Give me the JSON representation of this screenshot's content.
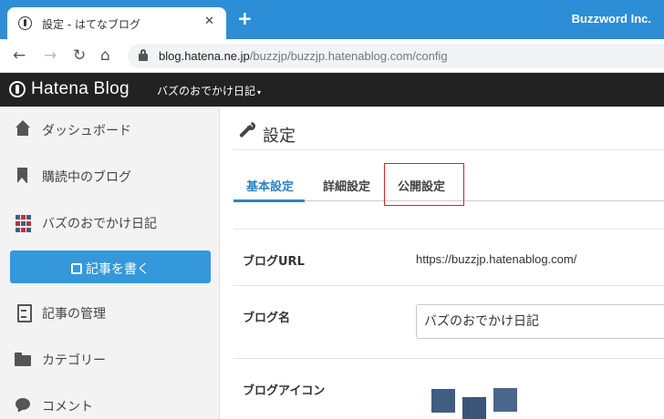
{
  "browser": {
    "tab_title": "設定 - はてなブログ",
    "tab_close": "✕",
    "new_tab": "+",
    "profile": "Buzzword Inc.",
    "url_host": "blog.hatena.ne.jp",
    "url_path": "/buzzjp/buzzjp.hatenablog.com/config",
    "nav": {
      "back": "←",
      "forward": "→",
      "reload": "↻",
      "home": "⌂"
    }
  },
  "header": {
    "brand": "Hatena Blog",
    "blog_name": "バズのおでかけ日記",
    "caret": "▾"
  },
  "sidebar": {
    "items": [
      {
        "label": "ダッシュボード",
        "icon": "home-icon"
      },
      {
        "label": "購読中のブログ",
        "icon": "bookmark-icon"
      },
      {
        "label": "バズのおでかけ日記",
        "icon": "blog-icon"
      }
    ],
    "write_button": "記事を書く",
    "items2": [
      {
        "label": "記事の管理",
        "icon": "document-icon"
      },
      {
        "label": "カテゴリー",
        "icon": "folder-icon"
      },
      {
        "label": "コメント",
        "icon": "comment-icon"
      }
    ]
  },
  "main": {
    "title": "設定",
    "tabs": [
      {
        "label": "基本設定",
        "active": true
      },
      {
        "label": "詳細設定",
        "active": false
      },
      {
        "label": "公開設定",
        "active": false,
        "highlighted": true
      }
    ],
    "rows": {
      "url_label": "ブログURL",
      "url_value": "https://buzzjp.hatenablog.com/",
      "name_label": "ブログ名",
      "name_value": "バズのおでかけ日記",
      "icon_label": "ブログアイコン"
    }
  },
  "colors": {
    "tabstrip": "#2c8ed6",
    "header": "#222222",
    "accent": "#2d83c4",
    "write_button": "#3598db",
    "highlight": "#e02020"
  }
}
